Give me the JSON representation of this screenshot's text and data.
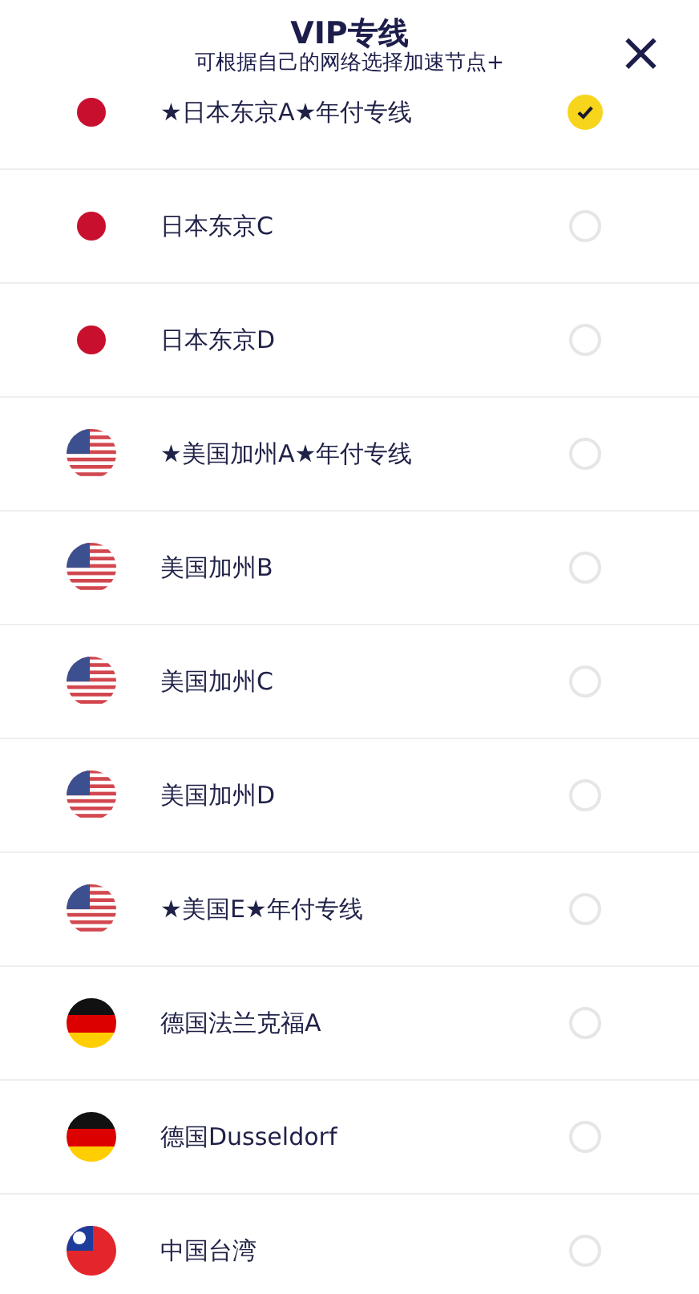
{
  "header": {
    "title": "VIP专线",
    "subtitle": "可根据自己的网络选择加速节点+",
    "close": "×"
  },
  "nodes": [
    {
      "kind": "jp",
      "name": "★日本东京A★年付专线",
      "selected": true
    },
    {
      "kind": "jp",
      "name": "日本东京C",
      "selected": false
    },
    {
      "kind": "jp",
      "name": "日本东京D",
      "selected": false
    },
    {
      "kind": "us",
      "name": "★美国加州A★年付专线",
      "selected": false
    },
    {
      "kind": "us",
      "name": "美国加州B",
      "selected": false
    },
    {
      "kind": "us",
      "name": "美国加州C",
      "selected": false
    },
    {
      "kind": "us",
      "name": "美国加州D",
      "selected": false
    },
    {
      "kind": "us",
      "name": "★美国E★年付专线",
      "selected": false
    },
    {
      "kind": "de",
      "name": "德国法兰克福A",
      "selected": false
    },
    {
      "kind": "de",
      "name": "德国Dusseldorf",
      "selected": false
    },
    {
      "kind": "tw",
      "name": "中国台湾",
      "selected": false
    }
  ]
}
